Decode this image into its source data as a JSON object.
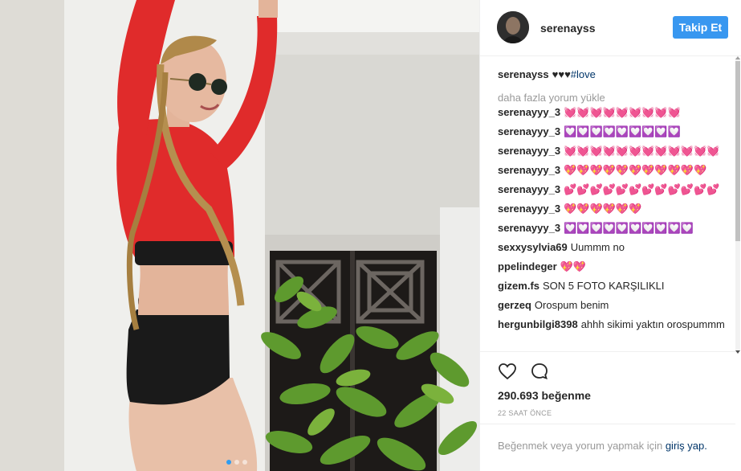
{
  "post": {
    "username": "serenayss",
    "follow_label": "Takip Et",
    "caption": {
      "user": "serenayss",
      "text": "♥♥♥",
      "hashtag": "#love"
    },
    "load_more": "daha fazla yorum yükle",
    "comments": [
      {
        "user": "serenayyy_3",
        "text": "💓💓💓💓💓💓💓💓💓"
      },
      {
        "user": "serenayyy_3",
        "text": "💟💟💟💟💟💟💟💟💟"
      },
      {
        "user": "serenayyy_3",
        "text": "💓💓💓💓💓💓💓💓💓💓💓💓"
      },
      {
        "user": "serenayyy_3",
        "text": "💖💖💖💖💖💖💖💖💖💖💖"
      },
      {
        "user": "serenayyy_3",
        "text": "💕💕💕💕💕💕💕💕💕💕💕💕"
      },
      {
        "user": "serenayyy_3",
        "text": "💖💖💖💖💖💖"
      },
      {
        "user": "serenayyy_3",
        "text": "💟💟💟💟💟💟💟💟💟💟"
      },
      {
        "user": "sexxysylvia69",
        "text": "Uummm no"
      },
      {
        "user": "ppelindeger",
        "text": "💖💖"
      },
      {
        "user": "gizem.fs",
        "text": "SON 5 FOTO KARŞILIKLI"
      },
      {
        "user": "gerzeq",
        "text": "Orospum benim"
      },
      {
        "user": "hergunbilgi8398",
        "text": "ahhh sikimi yaktın orospummm"
      }
    ],
    "likes": "290.693 beğenme",
    "time": "22 SAAT ÖNCE",
    "login_prefix": "Beğenmek veya yorum yapmak için",
    "login_link": "giriş yap.",
    "icons": {
      "like": "heart-icon",
      "comment": "comment-icon"
    },
    "carousel": {
      "count": 3,
      "active": 0
    },
    "colors": {
      "follow_button": "#3897f0",
      "active_dot": "#2f9cf0",
      "link": "#003569"
    }
  }
}
